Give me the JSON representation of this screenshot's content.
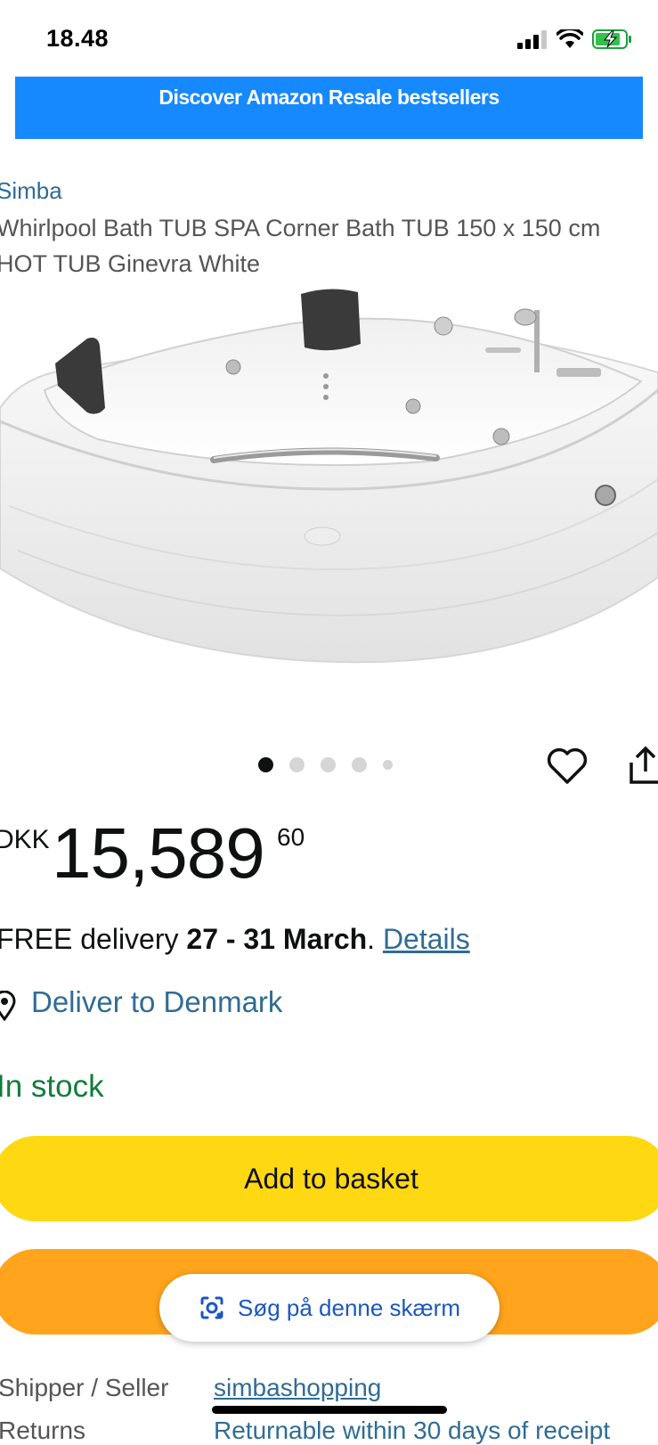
{
  "status_bar": {
    "time": "18.48",
    "icons": [
      "signal-icon",
      "wifi-icon",
      "battery-charging-icon"
    ]
  },
  "banner": {
    "text": "Discover Amazon Resale bestsellers",
    "color": "#1689ff"
  },
  "product": {
    "brand": "Simba",
    "title": "Whirlpool Bath TUB SPA Corner Bath TUB 150 x 150 cm HOT TUB Ginevra White",
    "image_alt": "Corner whirlpool bathtub",
    "carousel_total": 5,
    "carousel_active": 1
  },
  "price": {
    "currency": "DKK",
    "whole": "15,589",
    "fraction": "60"
  },
  "delivery": {
    "prefix": "FREE delivery ",
    "dates": "27 - 31 March",
    "suffix": ". ",
    "details_link": "Details"
  },
  "deliver_to": "Deliver to Denmark",
  "stock": "In stock",
  "buttons": {
    "add_to_basket": "Add to basket",
    "lens": "Søg på denne skærm"
  },
  "info_rows": [
    {
      "label": "Shipper / Seller",
      "value": "simbashopping"
    },
    {
      "label": "Returns",
      "value": "Returnable within 30 days of receipt"
    }
  ],
  "colors": {
    "add_to_basket": "#ffd814",
    "buy_now": "#ffa41c",
    "link": "#2f6c95",
    "in_stock": "#127d3c"
  }
}
